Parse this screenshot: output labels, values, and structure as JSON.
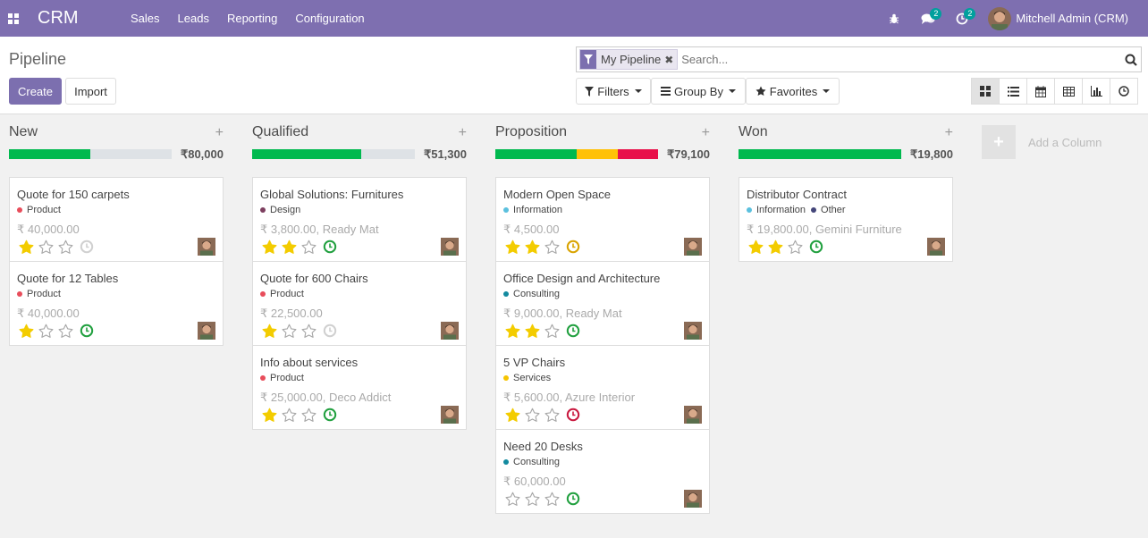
{
  "navbar": {
    "brand": "CRM",
    "menu": [
      "Sales",
      "Leads",
      "Reporting",
      "Configuration"
    ],
    "messages_count": "2",
    "activities_count": "2",
    "user_name": "Mitchell Admin (CRM)"
  },
  "control_panel": {
    "title": "Pipeline",
    "create_label": "Create",
    "import_label": "Import",
    "facet_label": "My Pipeline",
    "search_placeholder": "Search...",
    "filters_label": "Filters",
    "groupby_label": "Group By",
    "favorites_label": "Favorites",
    "views": [
      "kanban-view",
      "list-view",
      "calendar-view",
      "pivot-view",
      "graph-view",
      "activity-view"
    ],
    "active_view": "kanban-view"
  },
  "colors": {
    "navbar": "#7e6fb0",
    "primary": "#7c6faf",
    "progress_green": "#00b94f",
    "progress_yellow": "#ffc107",
    "progress_red": "#e8104a",
    "progress_grey": "#dee2e6",
    "star_on": "#f3cc00",
    "star_off": "#a8a8a8"
  },
  "columns": [
    {
      "title": "New",
      "sum": "₹80,000",
      "progress": [
        {
          "color": "green",
          "fraction": 0.5
        }
      ],
      "cards": [
        {
          "name": "Quote for 150 carpets",
          "tags": [
            {
              "label": "Product",
              "color": "#e84d5b"
            }
          ],
          "amount": "₹ 40,000.00",
          "stars": 1,
          "activity": "none"
        },
        {
          "name": "Quote for 12 Tables",
          "tags": [
            {
              "label": "Product",
              "color": "#e84d5b"
            }
          ],
          "amount": "₹ 40,000.00",
          "stars": 1,
          "activity": "planned"
        }
      ]
    },
    {
      "title": "Qualified",
      "sum": "₹51,300",
      "progress": [
        {
          "color": "green",
          "fraction": 0.67
        }
      ],
      "cards": [
        {
          "name": "Global Solutions: Furnitures",
          "tags": [
            {
              "label": "Design",
              "color": "#7d3f5f"
            }
          ],
          "amount": "₹ 3,800.00, Ready Mat",
          "stars": 2,
          "activity": "planned"
        },
        {
          "name": "Quote for 600 Chairs",
          "tags": [
            {
              "label": "Product",
              "color": "#e84d5b"
            }
          ],
          "amount": "₹ 22,500.00",
          "stars": 1,
          "activity": "none"
        },
        {
          "name": "Info about services",
          "tags": [
            {
              "label": "Product",
              "color": "#e84d5b"
            }
          ],
          "amount": "₹ 25,000.00, Deco Addict",
          "stars": 1,
          "activity": "planned"
        }
      ]
    },
    {
      "title": "Proposition",
      "sum": "₹79,100",
      "progress": [
        {
          "color": "green",
          "fraction": 0.5
        },
        {
          "color": "yellow",
          "fraction": 0.25
        },
        {
          "color": "red",
          "fraction": 0.25
        }
      ],
      "cards": [
        {
          "name": "Modern Open Space",
          "tags": [
            {
              "label": "Information",
              "color": "#5bc0de"
            }
          ],
          "amount": "₹ 4,500.00",
          "stars": 2,
          "activity": "today"
        },
        {
          "name": "Office Design and Architecture",
          "tags": [
            {
              "label": "Consulting",
              "color": "#138a9f"
            }
          ],
          "amount": "₹ 9,000.00, Ready Mat",
          "stars": 2,
          "activity": "planned"
        },
        {
          "name": "5 VP Chairs",
          "tags": [
            {
              "label": "Services",
              "color": "#f6c400"
            }
          ],
          "amount": "₹ 5,600.00, Azure Interior",
          "stars": 1,
          "activity": "overdue"
        },
        {
          "name": "Need 20 Desks",
          "tags": [
            {
              "label": "Consulting",
              "color": "#138a9f"
            }
          ],
          "amount": "₹ 60,000.00",
          "stars": 0,
          "activity": "planned"
        }
      ]
    },
    {
      "title": "Won",
      "sum": "₹19,800",
      "progress": [
        {
          "color": "green",
          "fraction": 1
        }
      ],
      "cards": [
        {
          "name": "Distributor Contract",
          "tags": [
            {
              "label": "Information",
              "color": "#5bc0de"
            },
            {
              "label": "Other",
              "color": "#44467a"
            }
          ],
          "amount": "₹ 19,800.00, Gemini Furniture",
          "stars": 2,
          "activity": "planned"
        }
      ]
    }
  ],
  "add_column_label": "Add a Column"
}
